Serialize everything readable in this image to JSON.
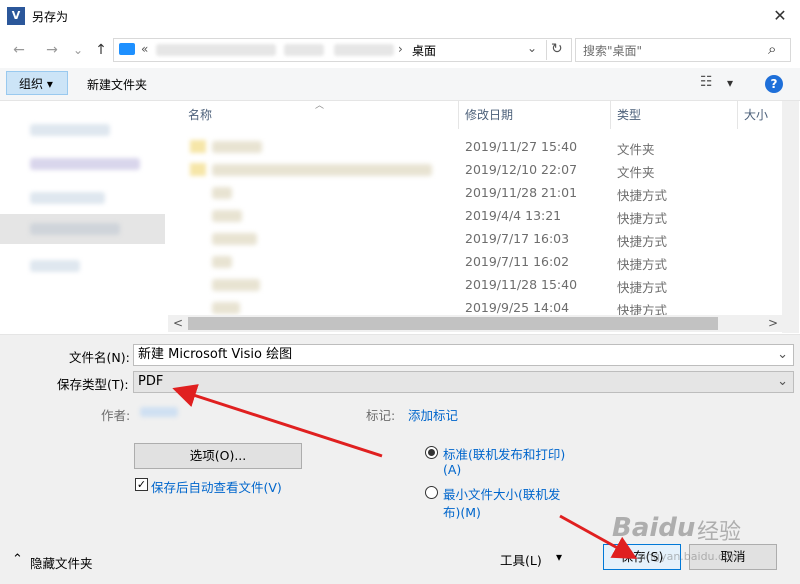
{
  "window": {
    "title": "另存为",
    "app_icon": "V",
    "close_glyph": "✕"
  },
  "nav": {
    "back_icon": "←",
    "forward_icon": "→",
    "dropdown_icon": "⌄",
    "up_icon": "↑",
    "address_prefix": "«",
    "address_current": "桌面",
    "address_sep": "›",
    "refresh_icon": "↻",
    "search_placeholder": "搜索\"桌面\"",
    "search_icon": "⌕"
  },
  "toolbar": {
    "organize": "组织 ▾",
    "new_folder": "新建文件夹",
    "view_icon": "☷",
    "view_drop": "▾",
    "help": "?"
  },
  "columns": {
    "name": "名称",
    "date": "修改日期",
    "type": "类型",
    "size": "大小"
  },
  "files": [
    {
      "date": "2019/11/27 15:40",
      "type": "文件夹"
    },
    {
      "date": "2019/12/10 22:07",
      "type": "文件夹"
    },
    {
      "date": "2019/11/28 21:01",
      "type": "快捷方式"
    },
    {
      "date": "2019/4/4 13:21",
      "type": "快捷方式"
    },
    {
      "date": "2019/7/17 16:03",
      "type": "快捷方式"
    },
    {
      "date": "2019/7/11 16:02",
      "type": "快捷方式"
    },
    {
      "date": "2019/11/28 15:40",
      "type": "快捷方式"
    },
    {
      "date": "2019/9/25 14:04",
      "type": "快捷方式"
    }
  ],
  "scroll": {
    "left": "<",
    "right": ">"
  },
  "form": {
    "filename_label": "文件名(N):",
    "filename_value": "新建 Microsoft Visio 绘图",
    "filetype_label": "保存类型(T):",
    "filetype_value": "PDF",
    "author_label": "作者:",
    "tags_label": "标记:",
    "tags_link": "添加标记",
    "options_button": "选项(O)...",
    "auto_view_label": "保存后自动查看文件(V)",
    "radio_standard_1": "标准(联机发布和打印)",
    "radio_standard_2": "(A)",
    "radio_min_1": "最小文件大小(联机发",
    "radio_min_2": "布)(M)",
    "check": "✓"
  },
  "footer": {
    "hide_folders": "隐藏文件夹",
    "tools": "工具(L)",
    "save": "保存(S)",
    "cancel": "取消",
    "hide_icon": "⌃",
    "tools_drop": "▾"
  },
  "watermark": {
    "brand": "Baidu",
    "brand_cn": "经验",
    "url": "jingyan.baidu.com"
  },
  "colors": {
    "accent": "#0066cc",
    "arrow": "#e02020",
    "selected": "#cce4f7"
  }
}
